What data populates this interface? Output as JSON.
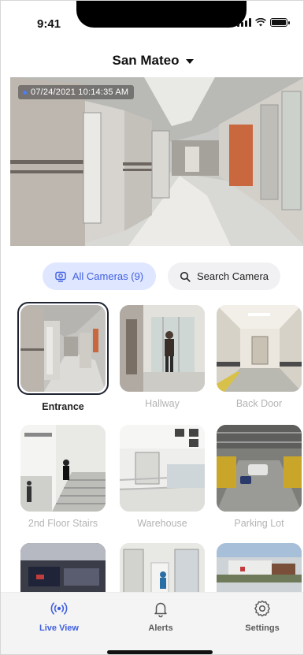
{
  "status_bar": {
    "time": "9:41"
  },
  "header": {
    "location": "San Mateo"
  },
  "main_video": {
    "timestamp": "07/24/2021 10:14:35 AM"
  },
  "filters": {
    "all_cameras_label": "All Cameras (9)",
    "search_label": "Search Camera"
  },
  "cameras": [
    {
      "label": "Entrance",
      "selected": true
    },
    {
      "label": "Hallway",
      "selected": false
    },
    {
      "label": "Back Door",
      "selected": false
    },
    {
      "label": "2nd Floor Stairs",
      "selected": false
    },
    {
      "label": "Warehouse",
      "selected": false
    },
    {
      "label": "Parking Lot",
      "selected": false
    },
    {
      "label": "",
      "selected": false
    },
    {
      "label": "",
      "selected": false
    },
    {
      "label": "",
      "selected": false
    }
  ],
  "tabbar": {
    "live_view": "Live View",
    "alerts": "Alerts",
    "settings": "Settings"
  },
  "colors": {
    "accent": "#3f5fe0",
    "chip_active_bg": "#dfe6ff",
    "chip_bg": "#f1f1f3",
    "tabbar_bg": "#f4f4f4"
  }
}
